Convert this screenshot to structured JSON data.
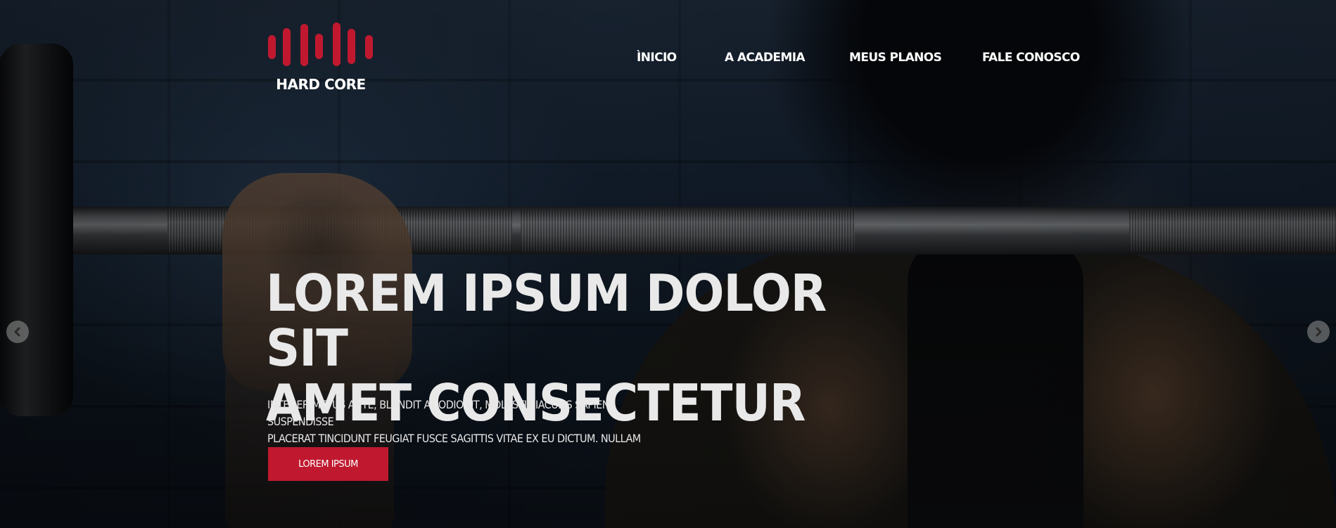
{
  "brand": {
    "name": "HARD CORE",
    "logo_icon": "sound-wave-icon",
    "accent_color": "#c0192f"
  },
  "nav": {
    "items": [
      {
        "label": "ÌNICIO"
      },
      {
        "label": "A ACADEMIA"
      },
      {
        "label": "MEUS PLANOS"
      },
      {
        "label": "FALE CONOSCO"
      }
    ]
  },
  "hero": {
    "headline_line1": "LOREM IPSUM DOLOR SIT",
    "headline_line2": "AMET CONSECTETUR",
    "subtext_line1": "INTEGER METUS ANTE, BLANDIT AT ODIO UT, MOLESTIE IACULIS SAPIEN. SUSPENDISSE",
    "subtext_line2": "PLACERAT TINCIDUNT FEUGIAT FUSCE SAGITTIS VITAE EX EU DICTUM. NULLAM FACILISIS.",
    "cta_label": "LOREM IPSUM"
  },
  "slider": {
    "prev_icon": "chevron-left-icon",
    "next_icon": "chevron-right-icon"
  }
}
